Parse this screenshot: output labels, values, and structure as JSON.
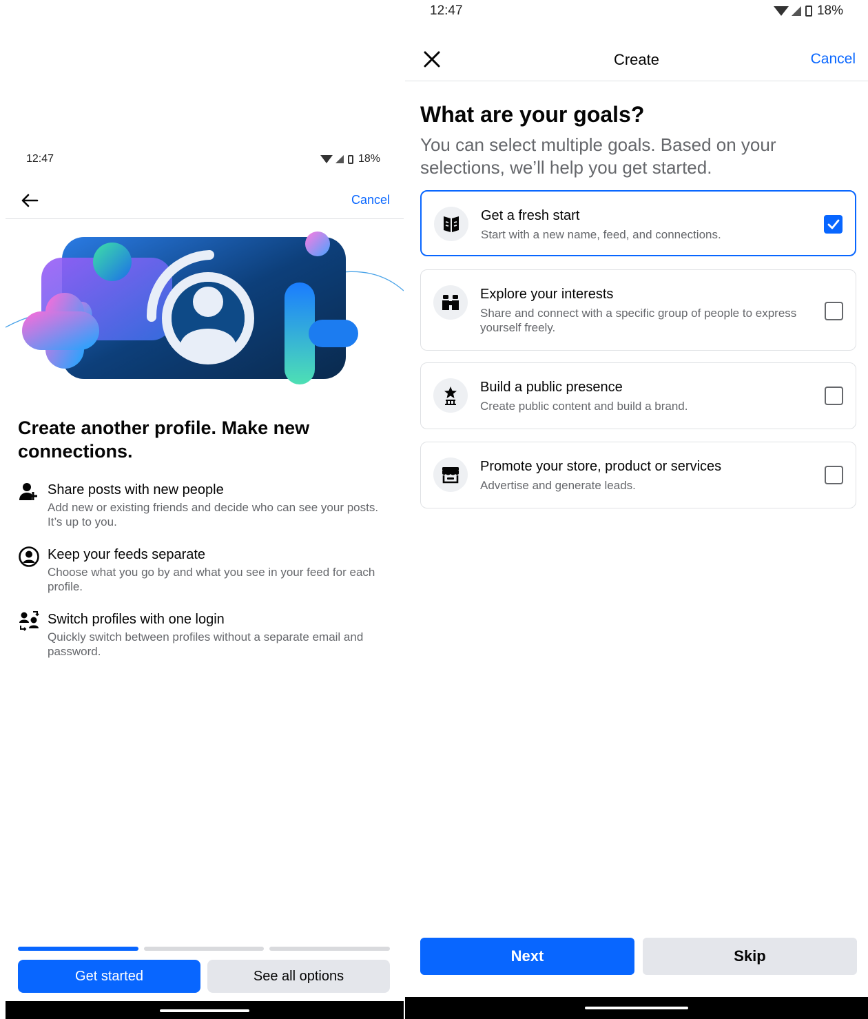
{
  "left_screen": {
    "status_bar": {
      "time": "12:47",
      "battery": "18%"
    },
    "header": {
      "cancel_label": "Cancel"
    },
    "title": "Create another profile. Make new connections.",
    "features": [
      {
        "icon": "add-person-icon",
        "title": "Share posts with new people",
        "description": "Add new or existing friends and decide who can see your posts. It’s up to you."
      },
      {
        "icon": "profile-circle-icon",
        "title": "Keep your feeds separate",
        "description": "Choose what you go by and what you see in your feed for each profile."
      },
      {
        "icon": "switch-profiles-icon",
        "title": "Switch profiles with one login",
        "description": "Quickly switch between profiles without a separate email and password."
      }
    ],
    "progress": {
      "steps": 3,
      "current": 1
    },
    "buttons": {
      "primary": "Get started",
      "secondary": "See all options"
    }
  },
  "right_screen": {
    "status_bar": {
      "time": "12:47",
      "battery": "18%"
    },
    "header": {
      "title": "Create",
      "cancel_label": "Cancel"
    },
    "heading": "What are your goals?",
    "subheading": "You can select multiple goals. Based on your selections, we’ll help you get started.",
    "goals": [
      {
        "icon": "fresh-start-icon",
        "title": "Get a fresh start",
        "description": "Start with a new name, feed, and connections.",
        "checked": true
      },
      {
        "icon": "binoculars-icon",
        "title": "Explore your interests",
        "description": "Share and connect with a specific group of people to express yourself freely.",
        "checked": false
      },
      {
        "icon": "star-podium-icon",
        "title": "Build a public presence",
        "description": "Create public content and build a brand.",
        "checked": false
      },
      {
        "icon": "storefront-icon",
        "title": "Promote your store, product or services",
        "description": "Advertise and generate leads.",
        "checked": false
      }
    ],
    "buttons": {
      "primary": "Next",
      "secondary": "Skip"
    }
  },
  "colors": {
    "accent": "#0866ff",
    "secondary_button": "#e4e6eb",
    "muted_text": "#65676b",
    "divider": "#dfe1e4"
  }
}
